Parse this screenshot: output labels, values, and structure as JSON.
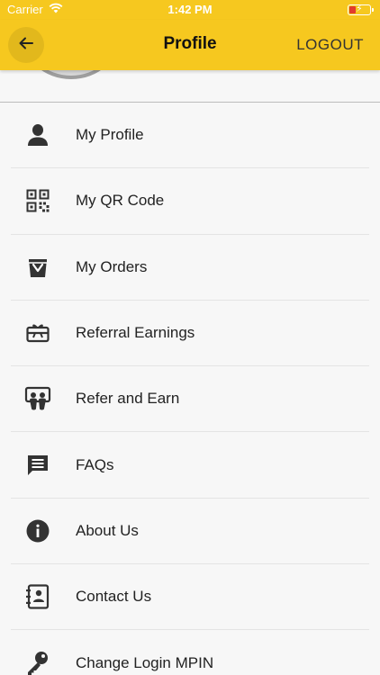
{
  "status_bar": {
    "carrier": "Carrier",
    "time": "1:42 PM"
  },
  "app_bar": {
    "title": "Profile",
    "logout_label": "LOGOUT"
  },
  "menu": {
    "items": [
      {
        "label": "My Profile",
        "icon": "person-icon"
      },
      {
        "label": "My QR Code",
        "icon": "qr-code-icon"
      },
      {
        "label": "My Orders",
        "icon": "shopping-bag-icon"
      },
      {
        "label": "Referral Earnings",
        "icon": "gift-card-icon"
      },
      {
        "label": "Refer and Earn",
        "icon": "refer-icon"
      },
      {
        "label": "FAQs",
        "icon": "chat-icon"
      },
      {
        "label": "About Us",
        "icon": "info-icon"
      },
      {
        "label": "Contact Us",
        "icon": "contact-book-icon"
      },
      {
        "label": "Change Login MPIN",
        "icon": "key-icon"
      }
    ]
  },
  "colors": {
    "accent": "#f6c81f",
    "icon": "#333333",
    "battery_low": "#e23b2e"
  }
}
